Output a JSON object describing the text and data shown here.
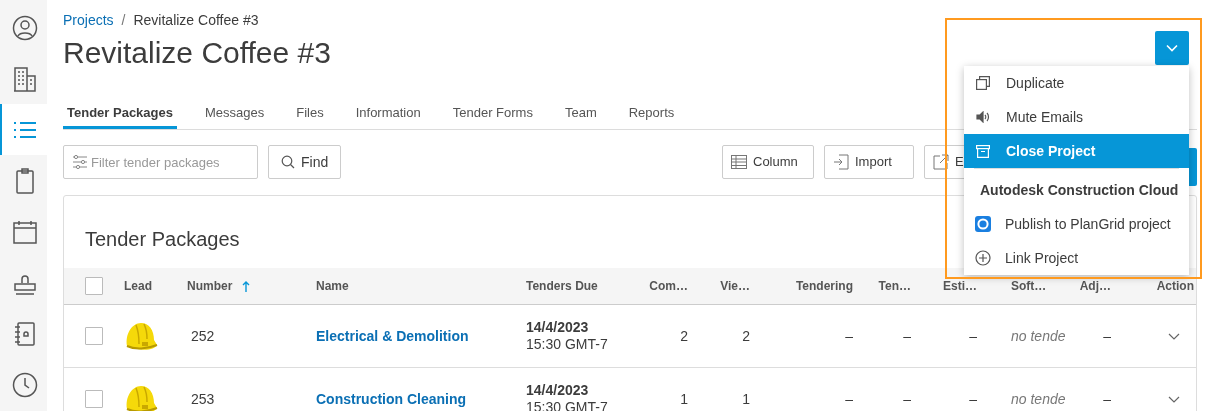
{
  "sidebar": {
    "items": [
      {
        "selected": false
      },
      {
        "selected": false
      },
      {
        "selected": true
      },
      {
        "selected": false
      },
      {
        "selected": false
      },
      {
        "selected": false
      },
      {
        "selected": false
      },
      {
        "selected": false
      }
    ]
  },
  "breadcrumb": {
    "link": "Projects",
    "separator": "/",
    "current": "Revitalize Coffee #3"
  },
  "title": "Revitalize Coffee #3",
  "tabs": [
    {
      "label": "Tender Packages",
      "selected": true
    },
    {
      "label": "Messages",
      "selected": false
    },
    {
      "label": "Files",
      "selected": false
    },
    {
      "label": "Information",
      "selected": false
    },
    {
      "label": "Tender Forms",
      "selected": false
    },
    {
      "label": "Team",
      "selected": false
    },
    {
      "label": "Reports",
      "selected": false
    }
  ],
  "toolbar": {
    "filter_placeholder": "Filter tender packages",
    "find": "Find",
    "buttons": [
      "Column",
      "Import",
      "E"
    ]
  },
  "card": {
    "title": "Tender Packages",
    "table": {
      "select_all_checked": false,
      "columns": [
        {
          "label": "Lead"
        },
        {
          "label": "Number",
          "sorted": true
        },
        {
          "label": "Name"
        },
        {
          "label": "Tenders Due"
        },
        {
          "label": "Com…"
        },
        {
          "label": "Vie…"
        },
        {
          "label": "Tendering"
        },
        {
          "label": "Ten…"
        },
        {
          "label": "Esti…"
        },
        {
          "label": "Soft…"
        },
        {
          "label": "Adj…"
        },
        {
          "label": "Action"
        }
      ],
      "rows": [
        {
          "checked": false,
          "number": "252",
          "name": "Electrical & Demolition",
          "due_date": "14/4/2023",
          "due_time": "15:30 GMT-7",
          "com": "2",
          "vie": "2",
          "tendering": "–",
          "ten": "–",
          "esti": "–",
          "soft": "no tende",
          "adj": "–"
        },
        {
          "checked": false,
          "number": "253",
          "name": "Construction Cleaning",
          "due_date": "14/4/2023",
          "due_time": "15:30 GMT-7",
          "com": "1",
          "vie": "1",
          "tendering": "–",
          "ten": "–",
          "esti": "–",
          "soft": "no tende",
          "adj": "–"
        }
      ]
    }
  },
  "menu": {
    "items": [
      {
        "label": "Duplicate",
        "selected": false
      },
      {
        "label": "Mute Emails",
        "selected": false
      },
      {
        "label": "Close Project",
        "selected": true
      }
    ],
    "section": {
      "title": "Autodesk Construction Cloud",
      "items": [
        {
          "label": "Publish to PlanGrid project"
        },
        {
          "label": "Link Project"
        }
      ]
    }
  }
}
